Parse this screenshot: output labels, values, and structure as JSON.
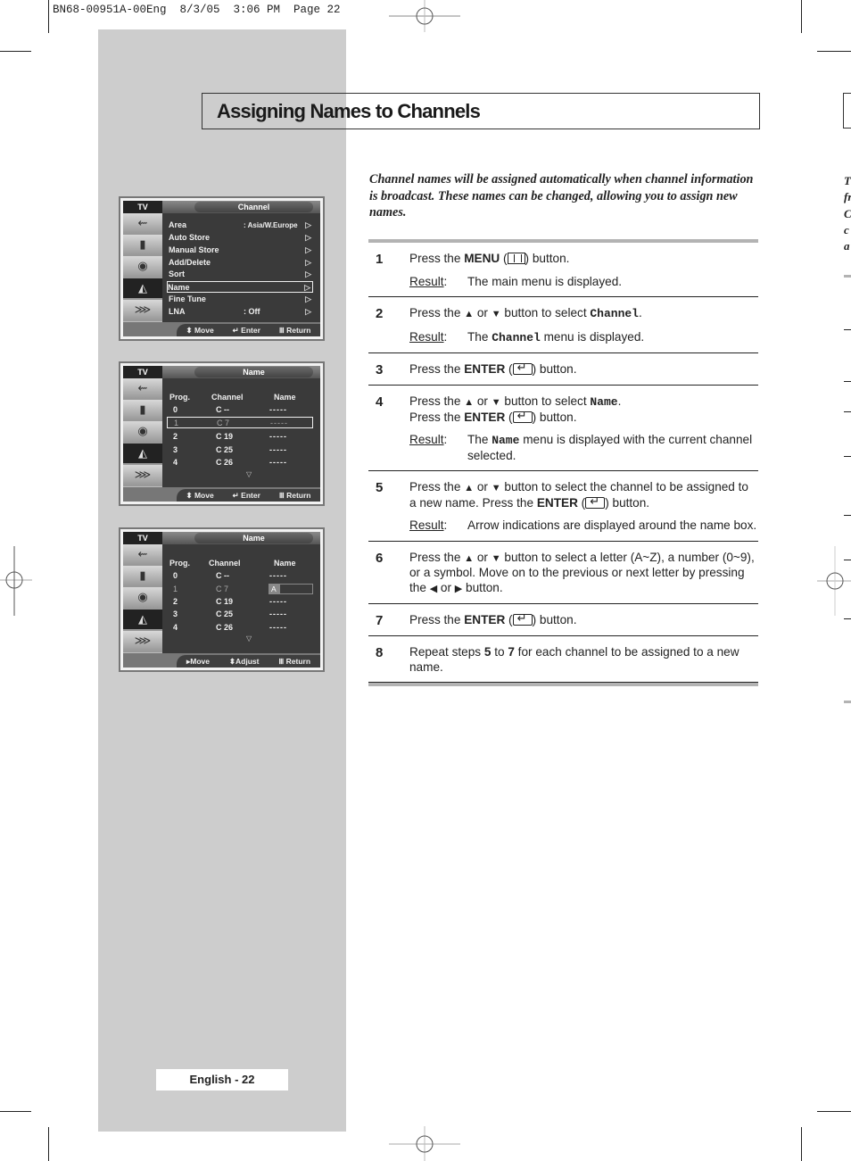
{
  "print_slug": "BN68-00951A-00Eng  8/3/05  3:06 PM  Page 22",
  "title": "Assigning Names to Channels",
  "intro": "Channel names will be assigned automatically when channel information is broadcast. These names can be changed, allowing you to assign new names.",
  "result_label": "Result",
  "steps": [
    {
      "num": "1",
      "parts": {
        "a": "Press the ",
        "b": "MENU",
        "c": " (",
        "d": ") button."
      },
      "result": "The main menu is displayed."
    },
    {
      "num": "2",
      "parts": {
        "a": "Press the ",
        "up": "▲",
        "or": " or ",
        "down": "▼",
        "c": " button to select ",
        "mono": "Channel",
        "d": "."
      },
      "result_pre": "The ",
      "result_mono": "Channel",
      "result_post": " menu is displayed."
    },
    {
      "num": "3",
      "parts": {
        "a": "Press the ",
        "b": "ENTER",
        "c": " (",
        "d": ") button."
      }
    },
    {
      "num": "4",
      "parts": {
        "a": "Press the ",
        "up": "▲",
        "or": " or ",
        "down": "▼",
        "c": " button to select ",
        "mono": "Name",
        "d": ".",
        "a2": "Press the ",
        "b2": "ENTER",
        "c2": " (",
        "d2": ") button."
      },
      "result_pre": "The ",
      "result_mono": "Name",
      "result_post": " menu is displayed with the current channel selected."
    },
    {
      "num": "5",
      "parts": {
        "a": "Press the ",
        "up": "▲",
        "or": " or ",
        "down": "▼",
        "c": " button to select the channel to be assigned to a new name.  Press the ",
        "b": "ENTER",
        "c2": " (",
        "d": ") button."
      },
      "result": "Arrow indications are displayed around the name box."
    },
    {
      "num": "6",
      "parts": {
        "a": "Press the ",
        "up": "▲",
        "or": " or ",
        "down": "▼",
        "c": " button to select a letter (A~Z), a number (0~9), or a symbol. Move on to the previous or next letter by pressing the ",
        "left": "◀",
        "or2": " or ",
        "right": "▶",
        "d": " button."
      }
    },
    {
      "num": "7",
      "parts": {
        "a": "Press the ",
        "b": "ENTER",
        "c": " (",
        "d": ") button."
      }
    },
    {
      "num": "8",
      "parts": {
        "a": "Repeat steps ",
        "b": "5",
        "c": " to ",
        "b2": "7",
        "d": " for each channel to be assigned to a new name."
      }
    }
  ],
  "osd_common": {
    "tv_label": "TV",
    "sidebar_icons": [
      "input-icon",
      "picture-icon",
      "sound-icon",
      "channel-icon",
      "setup-icon"
    ]
  },
  "osd1": {
    "header": "Channel",
    "items": [
      {
        "label": "Area",
        "value": ": Asia/W.Europe"
      },
      {
        "label": "Auto Store",
        "value": ""
      },
      {
        "label": "Manual Store",
        "value": ""
      },
      {
        "label": "Add/Delete",
        "value": ""
      },
      {
        "label": "Sort",
        "value": ""
      },
      {
        "label": "Name",
        "value": "",
        "selected": true
      },
      {
        "label": "Fine Tune",
        "value": ""
      },
      {
        "label": "LNA",
        "value": ": Off"
      }
    ],
    "footer": {
      "move": "Move",
      "enter": "Enter",
      "return": "Return"
    }
  },
  "osd2": {
    "header": "Name",
    "columns": [
      "Prog.",
      "Channel",
      "Name"
    ],
    "rows": [
      {
        "prog": "0",
        "channel": "C --",
        "name": "-----"
      },
      {
        "prog": "1",
        "channel": "C 7",
        "name": "-----",
        "selected": true
      },
      {
        "prog": "2",
        "channel": "C 19",
        "name": "-----"
      },
      {
        "prog": "3",
        "channel": "C 25",
        "name": "-----"
      },
      {
        "prog": "4",
        "channel": "C 26",
        "name": "-----"
      }
    ],
    "footer": {
      "move": "Move",
      "enter": "Enter",
      "return": "Return"
    }
  },
  "osd3": {
    "header": "Name",
    "columns": [
      "Prog.",
      "Channel",
      "Name"
    ],
    "rows": [
      {
        "prog": "0",
        "channel": "C --",
        "name": "-----"
      },
      {
        "prog": "1",
        "channel": "C 7",
        "name": "A",
        "editing": true
      },
      {
        "prog": "2",
        "channel": "C 19",
        "name": "-----"
      },
      {
        "prog": "3",
        "channel": "C 25",
        "name": "-----"
      },
      {
        "prog": "4",
        "channel": "C 26",
        "name": "-----"
      }
    ],
    "footer": {
      "move": "Move",
      "adjust": "Adjust",
      "return": "Return"
    }
  },
  "page_number": "English - 22",
  "right_edge_fragments": [
    "T",
    "fr",
    "C",
    "c",
    "a"
  ]
}
